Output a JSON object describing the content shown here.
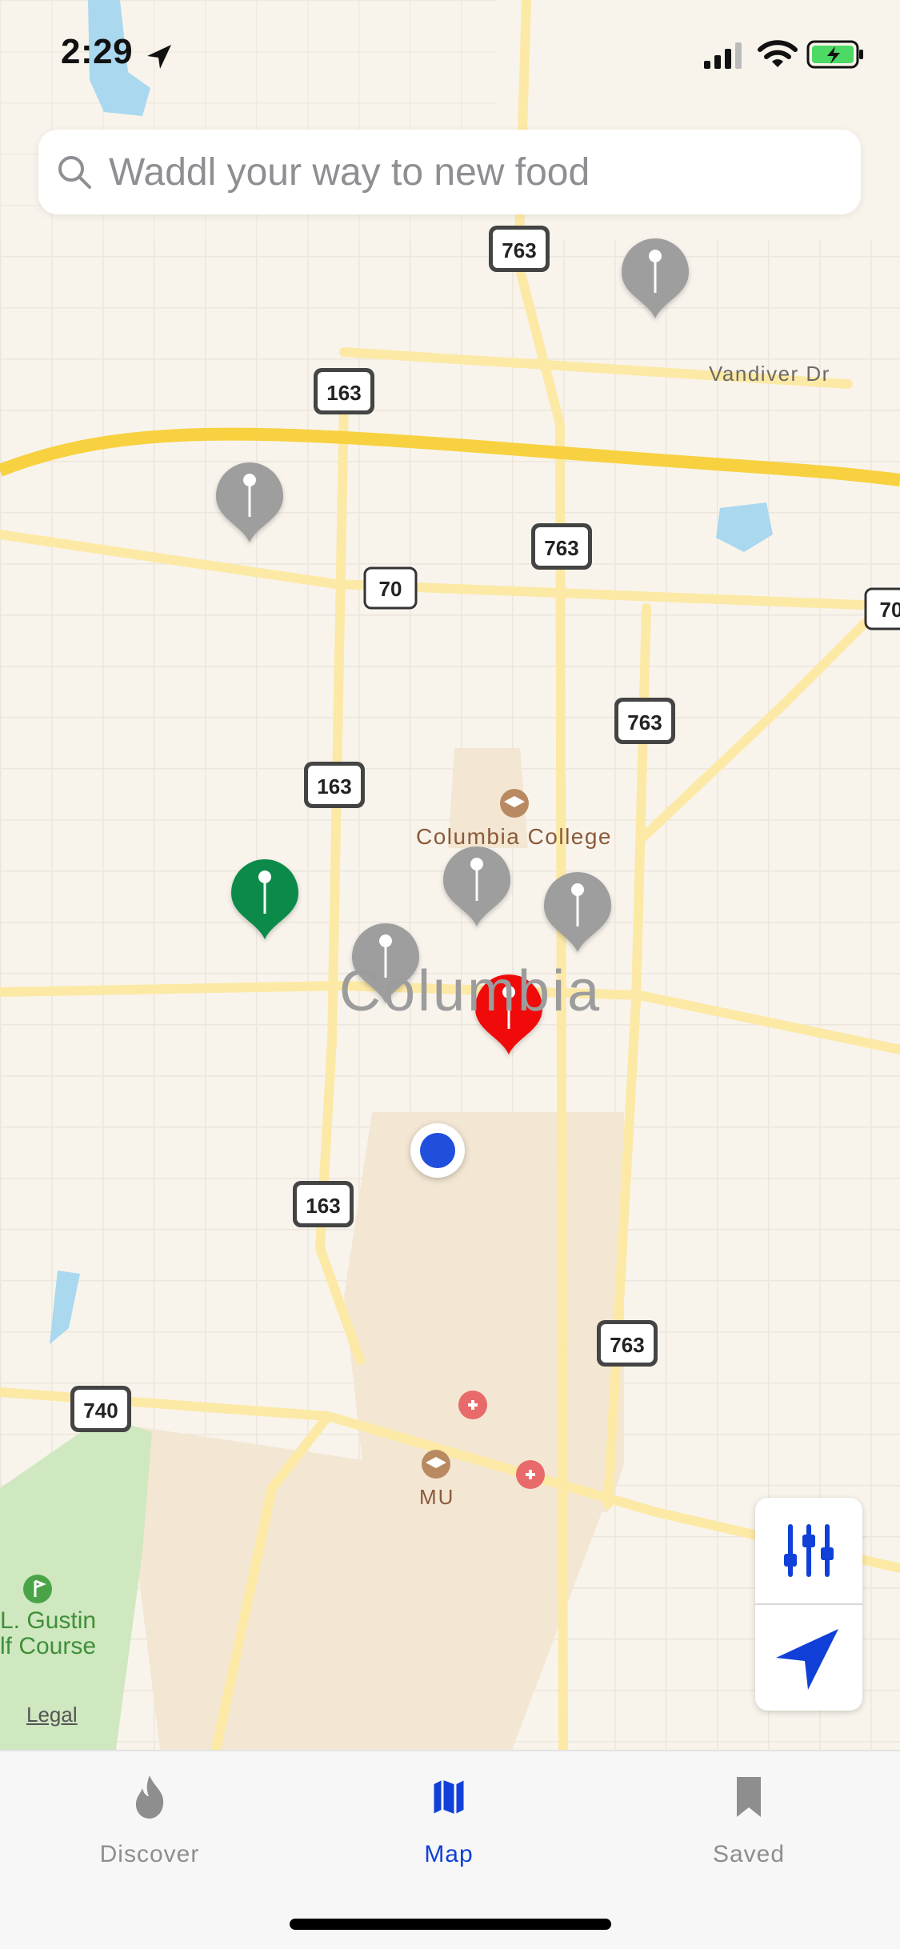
{
  "status_bar": {
    "time": "2:29"
  },
  "search": {
    "placeholder": "Waddl your way to new food"
  },
  "map": {
    "labels": {
      "vandiver_dr": "Vandiver Dr",
      "columbia_college": "Columbia College",
      "city": "Columbia",
      "mu": "MU",
      "gustin_line1": "L. Gustin",
      "gustin_line2": "lf Course",
      "legal": "Legal"
    },
    "route_shields": [
      "763",
      "163",
      "763",
      "70",
      "70",
      "763",
      "163",
      "163",
      "763",
      "740"
    ],
    "pins": [
      {
        "status": "gray",
        "color": "#9e9e9e"
      },
      {
        "status": "gray",
        "color": "#9e9e9e"
      },
      {
        "status": "green",
        "color": "#0c8a4a"
      },
      {
        "status": "gray",
        "color": "#9e9e9e"
      },
      {
        "status": "gray",
        "color": "#9e9e9e"
      },
      {
        "status": "gray",
        "color": "#9e9e9e"
      },
      {
        "status": "red",
        "color": "#f00a0a"
      }
    ],
    "user_location_color": "#1f4fdc"
  },
  "controls": {
    "filter_icon": "sliders-icon",
    "locate_icon": "location-arrow-icon",
    "accent": "#1040d8"
  },
  "tabs": [
    {
      "label": "Discover",
      "icon": "flame-icon",
      "active": false
    },
    {
      "label": "Map",
      "icon": "map-icon",
      "active": true
    },
    {
      "label": "Saved",
      "icon": "bookmark-icon",
      "active": false
    }
  ],
  "colors": {
    "tab_active": "#1040d8",
    "tab_inactive": "#8e8e8e"
  }
}
